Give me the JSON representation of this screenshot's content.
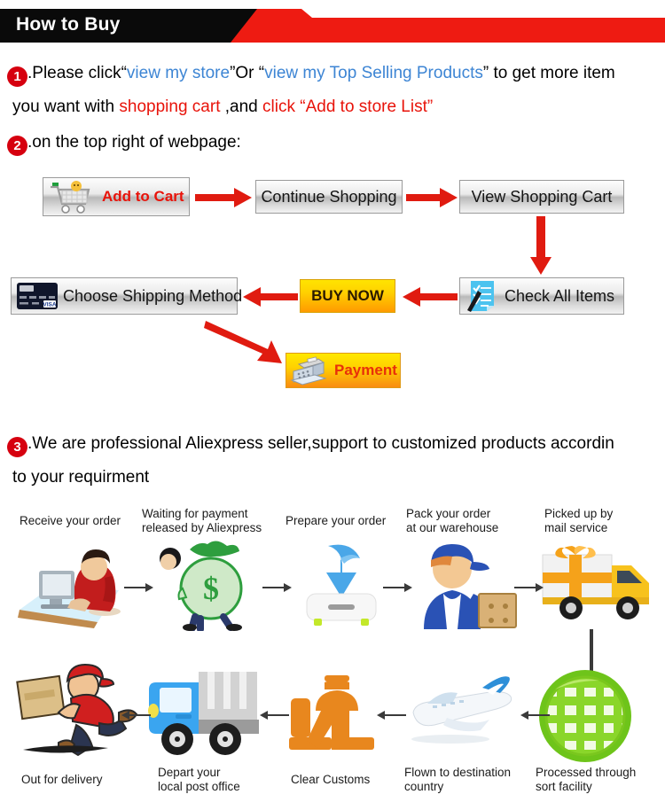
{
  "header": {
    "title": "How to Buy",
    "accent_red": "#ee1b12",
    "black": "#0a0a0a"
  },
  "steps": {
    "one": {
      "number": "1",
      "line1_a": ".Please click“",
      "line1_link1": "view my store",
      "line1_b": "”Or “",
      "line1_link2": "view my Top Selling Products",
      "line1_c": "” to get more item",
      "line2_a": "you want with ",
      "line2_red1": "shopping cart",
      "line2_b": " ,and ",
      "line2_red2": "click “Add to store List”"
    },
    "two": {
      "number": "2",
      "text": ".on the top right of webpage:"
    },
    "three": {
      "number": "3",
      "line1": ".We are professional Aliexpress seller,support to customized products accordin",
      "line2": "to your requirment"
    }
  },
  "flow_buttons": [
    {
      "id": "add-to-cart",
      "label": "Add to Cart",
      "icon": "shopping-cart-icon"
    },
    {
      "id": "continue-shopping",
      "label": "Continue Shopping",
      "icon": ""
    },
    {
      "id": "view-shopping-cart",
      "label": "View Shopping Cart",
      "icon": ""
    },
    {
      "id": "check-all-items",
      "label": "Check All Items",
      "icon": "checklist-icon"
    },
    {
      "id": "buy-now",
      "label": "BUY NOW",
      "icon": ""
    },
    {
      "id": "choose-shipping-method",
      "label": "Choose Shipping Method",
      "icon": "credit-card-icon"
    },
    {
      "id": "payment",
      "label": "Payment",
      "icon": "cash-register-icon"
    }
  ],
  "shipping_flow": {
    "row1": [
      {
        "caption_line1": "Receive your order",
        "caption_line2": "",
        "icon": "person-at-computer-icon"
      },
      {
        "caption_line1": "Waiting for payment",
        "caption_line2": "released by Aliexpress",
        "icon": "money-bag-icon"
      },
      {
        "caption_line1": "Prepare your order",
        "caption_line2": "",
        "icon": "download-arrow-icon"
      },
      {
        "caption_line1": "Pack your order",
        "caption_line2": "at our warehouse",
        "icon": "warehouse-worker-icon"
      },
      {
        "caption_line1": "Picked up by",
        "caption_line2": "mail service",
        "icon": "delivery-truck-icon"
      }
    ],
    "row2": [
      {
        "caption_line1": "Out for delivery",
        "caption_line2": "",
        "icon": "running-courier-icon"
      },
      {
        "caption_line1": "Depart your",
        "caption_line2": "local post office",
        "icon": "blue-truck-icon"
      },
      {
        "caption_line1": "Clear Customs",
        "caption_line2": "",
        "icon": "customs-officer-icon"
      },
      {
        "caption_line1": "Flown to destination",
        "caption_line2": "country",
        "icon": "airplane-icon"
      },
      {
        "caption_line1": "Processed through",
        "caption_line2": "sort facility",
        "icon": "green-globe-icon"
      }
    ]
  },
  "colors": {
    "red_arrow": "#e01b10",
    "link_blue": "#3d85d4",
    "text_red": "#e8130a"
  }
}
